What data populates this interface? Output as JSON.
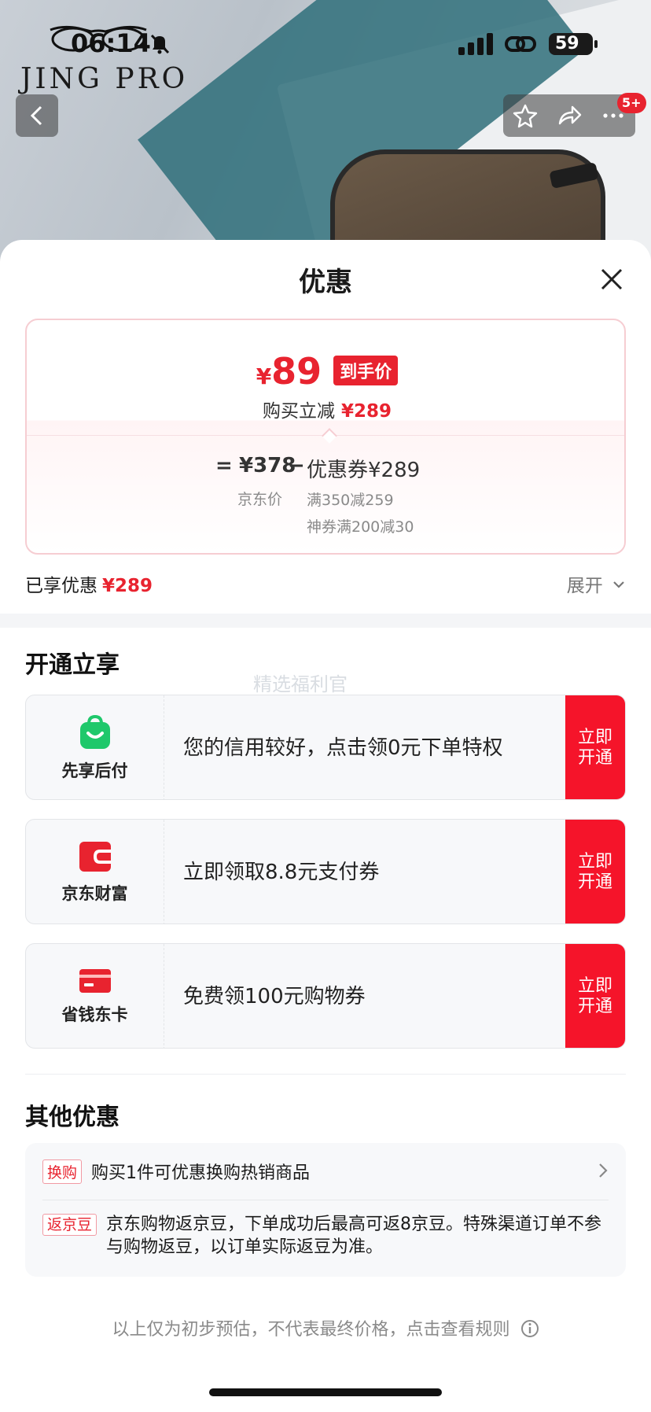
{
  "status_bar": {
    "time": "06:14",
    "battery": "59",
    "brand_logo": "JING PRO"
  },
  "header": {
    "cart_badge": "5+"
  },
  "sheet": {
    "title": "优惠",
    "price_card": {
      "currency": "¥",
      "final_price": "89",
      "final_tag": "到手价",
      "reduce_label": "购买立减",
      "reduce_value": "¥289",
      "equals": "=",
      "jd_price": "¥378",
      "jd_price_label": "京东价",
      "minus": "−",
      "coupon_label": "优惠券¥289",
      "coupon_detail_1": "满350减259",
      "coupon_detail_2": "神券满200减30"
    },
    "enjoyed": {
      "label": "已享优惠",
      "value": "¥289",
      "expand": "展开"
    },
    "open_section": {
      "title": "开通立享",
      "watermark": "精选福利官",
      "offers": [
        {
          "name": "先享后付",
          "text": "您的信用较好，点击领0元下单特权",
          "button": "立即开通",
          "icon_color": "#1fc86b"
        },
        {
          "name": "京东财富",
          "text": "立即领取8.8元支付券",
          "button": "立即开通",
          "icon_color": "#e8232f"
        },
        {
          "name": "省钱东卡",
          "text": "免费领100元购物券",
          "button": "立即开通",
          "icon_color": "#e8232f"
        }
      ]
    },
    "other_section": {
      "title": "其他优惠",
      "items": [
        {
          "tag": "换购",
          "text": "购买1件可优惠换购热销商品"
        },
        {
          "tag": "返京豆",
          "text": "京东购物返京豆，下单成功后最高可返8京豆。特殊渠道订单不参与购物返豆，以订单实际返豆为准。"
        }
      ]
    },
    "disclaimer": "以上仅为初步预估，不代表最终价格，点击查看规则"
  },
  "colors": {
    "accent": "#e8232f",
    "button_red": "#f5142a",
    "green": "#1fc86b"
  }
}
